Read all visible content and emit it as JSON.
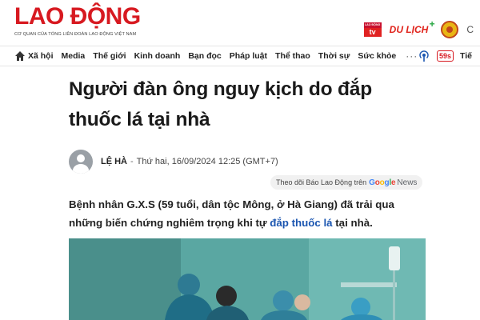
{
  "header": {
    "logo_text": "LAO ĐỘNG",
    "logo_sub": "CƠ QUAN CỦA TỔNG LIÊN ĐOÀN LAO ĐỘNG VIỆT NAM",
    "partners": {
      "tv_top": "LAO ĐỘNG",
      "tv_bottom": "tv",
      "dulich": "DU LỊCH",
      "dulich_plus": "+",
      "cutoff": "C"
    }
  },
  "nav": {
    "items": [
      "Xã hội",
      "Media",
      "Thế giới",
      "Kinh doanh",
      "Bạn đọc",
      "Pháp luật",
      "Thể thao",
      "Thời sự",
      "Sức khỏe"
    ],
    "more": "···",
    "age_badge": "59s",
    "right_text": "Tiế"
  },
  "article": {
    "title": "Người đàn ông nguy kịch do đắp thuốc lá tại nhà",
    "author": "LỆ HÀ",
    "sep": "-",
    "date": "Thứ hai, 16/09/2024 12:25 (GMT+7)",
    "follow_text": "Theo dõi Báo Lao Động trên",
    "google_news_news": "News",
    "lead_part1": "Bệnh nhân G.X.S (59 tuổi, dân tộc Mông, ở Hà Giang) đã trải qua những biến chứng nghiêm trọng khi tự ",
    "lead_link": "đắp thuốc lá",
    "lead_part2": " tại nhà."
  },
  "colors": {
    "brand_red": "#d71920",
    "link_blue": "#1a55b0"
  }
}
